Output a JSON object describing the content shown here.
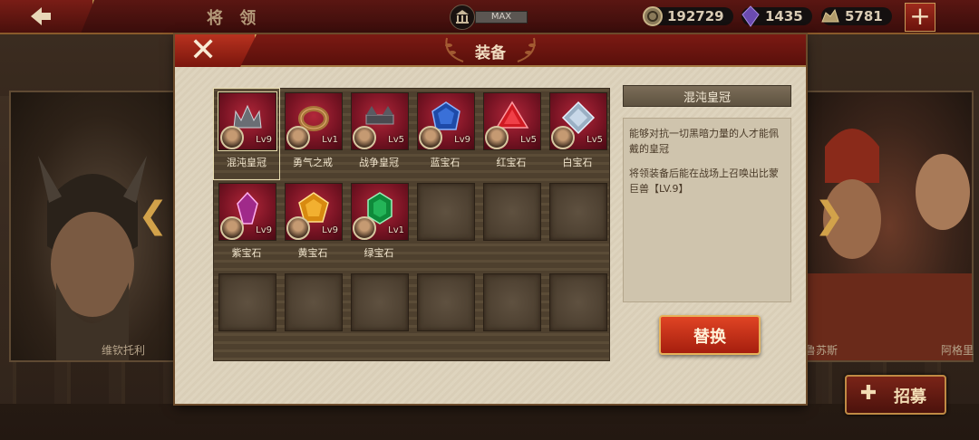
{
  "topbar": {
    "title": "将 领",
    "max_label": "MAX",
    "resources": [
      {
        "icon": "coin-icon",
        "value": "192729"
      },
      {
        "icon": "purple-gem-icon",
        "value": "1435"
      },
      {
        "icon": "ore-icon",
        "value": "5781"
      }
    ],
    "plus_label": "+"
  },
  "scene": {
    "left_hero_name": "维钦托利",
    "right_hero_name": "鲁苏斯",
    "right_hero_name_2": "阿格里",
    "recruit_label": "招募"
  },
  "modal": {
    "title": "装备",
    "close_label": "✕",
    "items": [
      {
        "label": "混沌皇冠",
        "level": "Lv9",
        "gem": "crown-dark",
        "selected": true
      },
      {
        "label": "勇气之戒",
        "level": "Lv1",
        "gem": "ring"
      },
      {
        "label": "战争皇冠",
        "level": "Lv5",
        "gem": "crown-war"
      },
      {
        "label": "蓝宝石",
        "level": "Lv9",
        "gem": "blue"
      },
      {
        "label": "红宝石",
        "level": "Lv5",
        "gem": "red"
      },
      {
        "label": "白宝石",
        "level": "Lv5",
        "gem": "white"
      },
      {
        "label": "紫宝石",
        "level": "Lv9",
        "gem": "purple"
      },
      {
        "label": "黄宝石",
        "level": "Lv9",
        "gem": "yellow"
      },
      {
        "label": "绿宝石",
        "level": "Lv1",
        "gem": "green"
      }
    ],
    "detail": {
      "title": "混沌皇冠",
      "desc_1": "能够对抗一切黑暗力量的人才能佩戴的皇冠",
      "desc_2": "将领装备后能在战场上召唤出比蒙巨兽【LV.9】"
    },
    "replace_label": "替换"
  }
}
